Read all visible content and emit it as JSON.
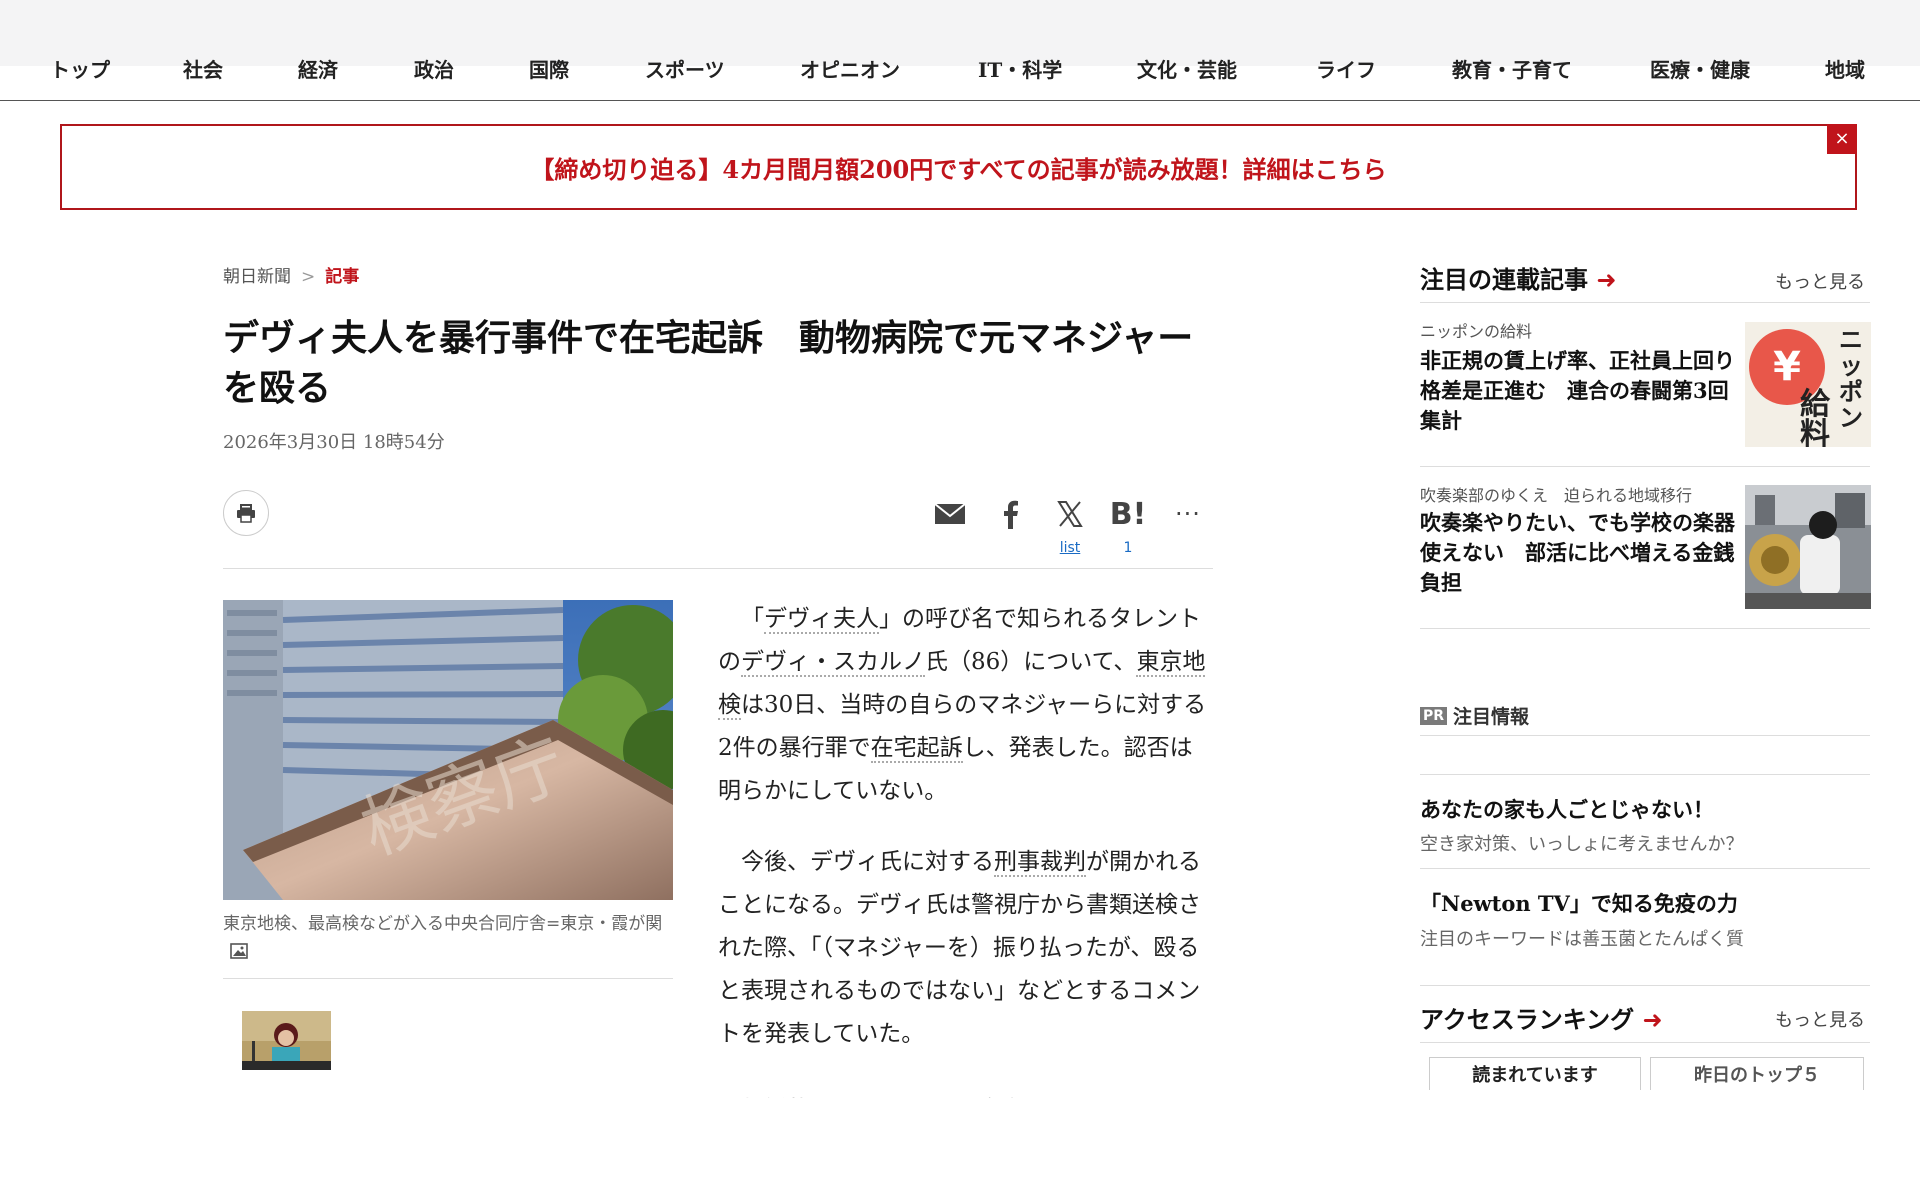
{
  "nav": {
    "items": [
      "トップ",
      "社会",
      "経済",
      "政治",
      "国際",
      "スポーツ",
      "オピニオン",
      "IT・科学",
      "文化・芸能",
      "ライフ",
      "教育・子育て",
      "医療・健康",
      "地域"
    ]
  },
  "promo": {
    "text": "【締め切り迫る】4カ月間月額200円ですべての記事が読み放題！詳細はこちら",
    "close": "×"
  },
  "breadcrumb": {
    "home": "朝日新聞",
    "sep": ">",
    "current": "記事"
  },
  "article": {
    "title": "デヴィ夫人を暴行事件で在宅起訴　動物病院で元マネジャーを殴る",
    "date": "2026年3月30日 18時54分",
    "share": {
      "x_count": "list",
      "hatena_count": "1"
    },
    "photo_caption": "東京地検、最高検などが入る中央合同庁舎=東京・霞が関",
    "paragraphs": [
      [
        "「",
        {
          "kw": "デヴィ夫人"
        },
        "」の呼び名で知られるタレントの",
        {
          "kw": "デヴィ・スカルノ"
        },
        "氏（86）について、",
        {
          "kw": "東京地検"
        },
        "は30日、当時の自らのマネジャーらに対する2件の暴行罪で",
        {
          "kw": "在宅起訴"
        },
        "し、発表した。認否は明らかにしていない。"
      ],
      [
        "今後、デヴィ氏に対する",
        {
          "kw": "刑事裁判"
        },
        "が開かれることになる。デヴィ氏は警視庁から書類送検された際、「（マネジャーを）振り払ったが、殴ると表現されるものではない」などとするコメントを発表していた。"
      ]
    ],
    "fade_text": "　起訴状などによると、デヴィ氏は"
  },
  "sidebar": {
    "series": {
      "heading": "注目の連載記事",
      "more": "もっと見る",
      "items": [
        {
          "kicker": "ニッポンの給料",
          "title": "非正規の賃上げ率、正社員上回り格差是正進む　連合の春闘第3回集計",
          "img_text": "ニッポンの給料"
        },
        {
          "kicker": "吹奏楽部のゆくえ　迫られる地域移行",
          "title": "吹奏楽やりたい、でも学校の楽器使えない　部活に比べ増える金銭負担"
        }
      ]
    },
    "pr": {
      "badge": "PR",
      "heading": "注目情報",
      "items": [
        {
          "title": "あなたの家も人ごとじゃない！",
          "sub": "空き家対策、いっしょに考えませんか？"
        },
        {
          "title": "「Newton TV」で知る免疫の力",
          "sub": "注目のキーワードは善玉菌とたんぱく質"
        }
      ]
    },
    "ranking": {
      "heading": "アクセスランキング",
      "more": "もっと見る",
      "tabs": [
        "読まれています",
        "昨日のトップ５"
      ]
    }
  },
  "colors": {
    "accent": "#c0141b",
    "link": "#1a6bc4"
  }
}
